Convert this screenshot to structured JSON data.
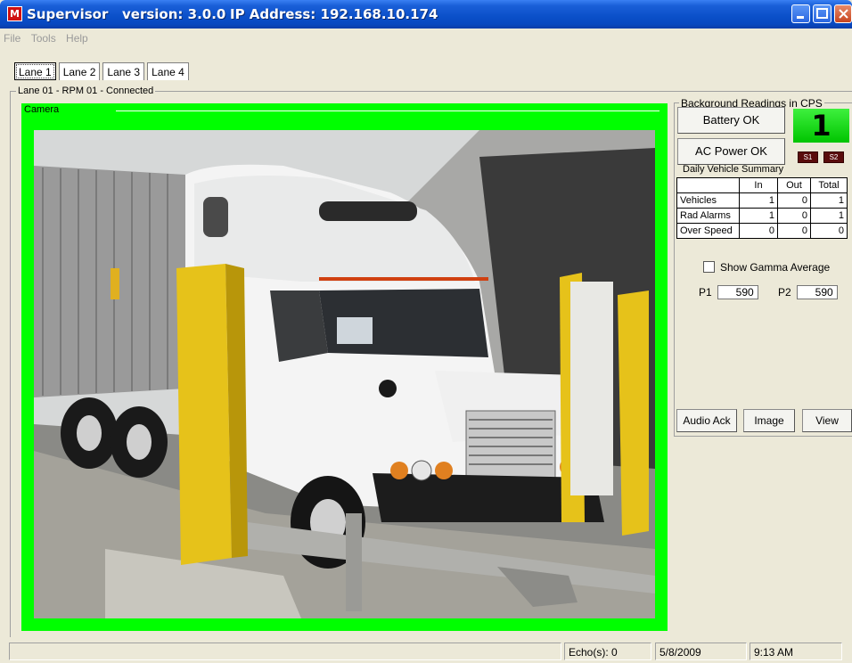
{
  "window": {
    "app_name": "Supervisor",
    "version_label": "version: 3.0.0",
    "ip_label": "IP Address: 192.168.10.174",
    "icon_letter": "M"
  },
  "menu": [
    "File",
    "Tools",
    "Help"
  ],
  "tabs": [
    "Lane 1",
    "Lane 2",
    "Lane 3",
    "Lane 4"
  ],
  "lane_status": "Lane 01 - RPM 01 - Connected",
  "camera": {
    "label": "Camera"
  },
  "right_panel": {
    "group_label": "Background Readings in CPS",
    "battery_label": "Battery OK",
    "ac_power_label": "AC Power OK",
    "count": "1",
    "s1": "S1",
    "s2": "S2",
    "summary_title": "Daily Vehicle Summary",
    "summary_headers": [
      "",
      "In",
      "Out",
      "Total"
    ],
    "summary_rows": [
      {
        "label": "Vehicles",
        "in": "1",
        "out": "0",
        "total": "1"
      },
      {
        "label": "Rad Alarms",
        "in": "1",
        "out": "0",
        "total": "1"
      },
      {
        "label": "Over Speed",
        "in": "0",
        "out": "0",
        "total": "0"
      }
    ],
    "gamma_label": "Show Gamma Average",
    "p1_label": "P1",
    "p1_value": "590",
    "p2_label": "P2",
    "p2_value": "590",
    "audio_ack_label": "Audio Ack",
    "image_label": "Image",
    "view_label": "View"
  },
  "statusbar": {
    "echo": "Echo(s): 0",
    "date": "5/8/2009",
    "time": "9:13 AM"
  },
  "colors": {
    "camera_border": "#00ff00",
    "count_box": "#00dd00",
    "titlebar": "#0a4fc8"
  }
}
